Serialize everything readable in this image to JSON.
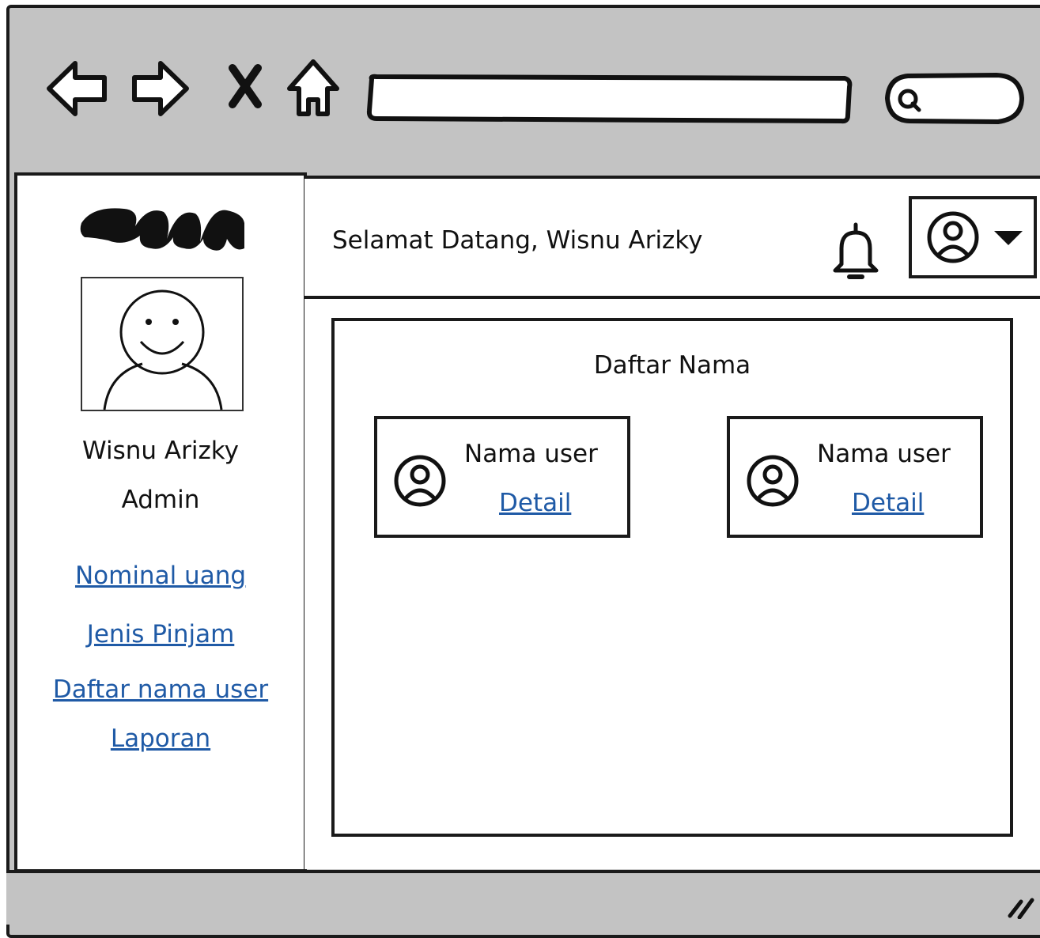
{
  "browser": {
    "address_value": "",
    "search_value": ""
  },
  "sidebar": {
    "user_name": "Wisnu Arizky",
    "role": "Admin",
    "links": [
      {
        "label": "Nominal uang"
      },
      {
        "label": "Jenis Pinjam"
      },
      {
        "label": "Daftar nama user"
      },
      {
        "label": "Laporan"
      }
    ]
  },
  "header": {
    "welcome": "Selamat Datang, Wisnu Arizky"
  },
  "main": {
    "title": "Daftar Nama",
    "users": [
      {
        "name": "Nama user",
        "link": "Detail"
      },
      {
        "name": "Nama user",
        "link": "Detail"
      }
    ]
  },
  "colors": {
    "link": "#1f5aa6",
    "chrome": "#c3c3c3",
    "ink": "#1a1a1a"
  }
}
